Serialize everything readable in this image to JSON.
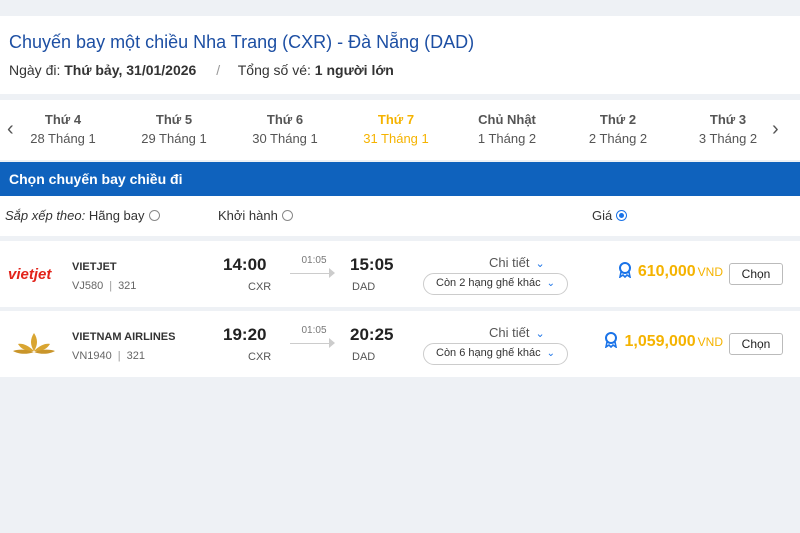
{
  "header": {
    "title": "Chuyến bay một chiều Nha Trang (CXR) - Đà Nẵng (DAD)",
    "date_label": "Ngày đi:",
    "date_value": "Thứ bảy, 31/01/2026",
    "separator": "/",
    "tickets_label": "Tổng số vé:",
    "tickets_value": "1 người lớn"
  },
  "dates": [
    {
      "dow": "Thứ 4",
      "date": "28 Tháng 1"
    },
    {
      "dow": "Thứ 5",
      "date": "29 Tháng 1"
    },
    {
      "dow": "Thứ 6",
      "date": "30 Tháng 1"
    },
    {
      "dow": "Thứ 7",
      "date": "31 Tháng 1",
      "active": true
    },
    {
      "dow": "Chủ Nhật",
      "date": "1 Tháng 2"
    },
    {
      "dow": "Thứ 2",
      "date": "2 Tháng 2"
    },
    {
      "dow": "Thứ 3",
      "date": "3 Tháng 2"
    }
  ],
  "section_title": "Chọn chuyến bay chiều đi",
  "sort": {
    "prefix": "Sắp xếp theo:",
    "airline": "Hãng bay",
    "departure": "Khởi hành",
    "price": "Giá",
    "selected": "price"
  },
  "flights": [
    {
      "airline": "VIETJET",
      "code": "VJ580",
      "aircraft": "321",
      "dep_time": "14:00",
      "dep_apt": "CXR",
      "duration": "01:05",
      "arr_time": "15:05",
      "arr_apt": "DAD",
      "detail": "Chi tiết",
      "seats": "Còn 2 hạng ghế khác",
      "price": "610,000",
      "currency": "VND",
      "choose": "Chọn",
      "logo_text": "vietjet",
      "logo_icon": "vietjet-logo"
    },
    {
      "airline": "VIETNAM AIRLINES",
      "code": "VN1940",
      "aircraft": "321",
      "dep_time": "19:20",
      "dep_apt": "CXR",
      "duration": "01:05",
      "arr_time": "20:25",
      "arr_apt": "DAD",
      "detail": "Chi tiết",
      "seats": "Còn 6 hạng ghế khác",
      "price": "1,059,000",
      "currency": "VND",
      "choose": "Chọn",
      "logo_icon": "lotus-logo"
    }
  ],
  "colors": {
    "title_blue": "#1d4fa3",
    "section_blue": "#0f62bd",
    "highlight_yellow": "#f5b300",
    "vietjet_red": "#e2231a",
    "vna_gold": "#d9a531"
  }
}
